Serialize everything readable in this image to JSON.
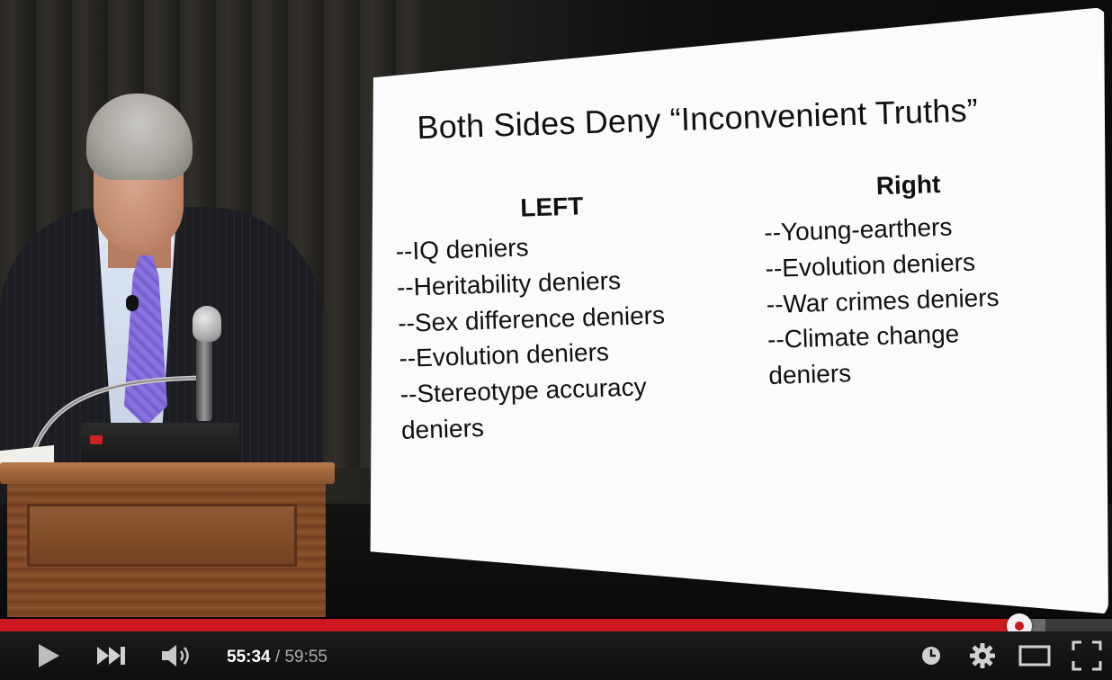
{
  "slide": {
    "title": "Both Sides Deny “Inconvenient Truths”",
    "left_heading": "LEFT",
    "right_heading": "Right",
    "left_items": [
      "--IQ deniers",
      "--Heritability deniers",
      "--Sex difference deniers",
      "--Evolution deniers",
      "--Stereotype accuracy\n   deniers"
    ],
    "right_items": [
      "--Young-earthers",
      "--Evolution deniers",
      "--War crimes deniers",
      "--Climate change\n   deniers"
    ]
  },
  "player": {
    "current_time": "55:34",
    "separator": " / ",
    "total_time": "59:55",
    "played_fraction": 0.917,
    "buffered_fraction": 0.94,
    "accent_color": "#cc181e",
    "icons": {
      "play": "play-icon",
      "next": "next-icon",
      "volume": "volume-icon",
      "watch_later": "clock-icon",
      "settings": "gear-icon",
      "theater": "theater-mode-icon",
      "fullscreen": "fullscreen-icon"
    }
  }
}
